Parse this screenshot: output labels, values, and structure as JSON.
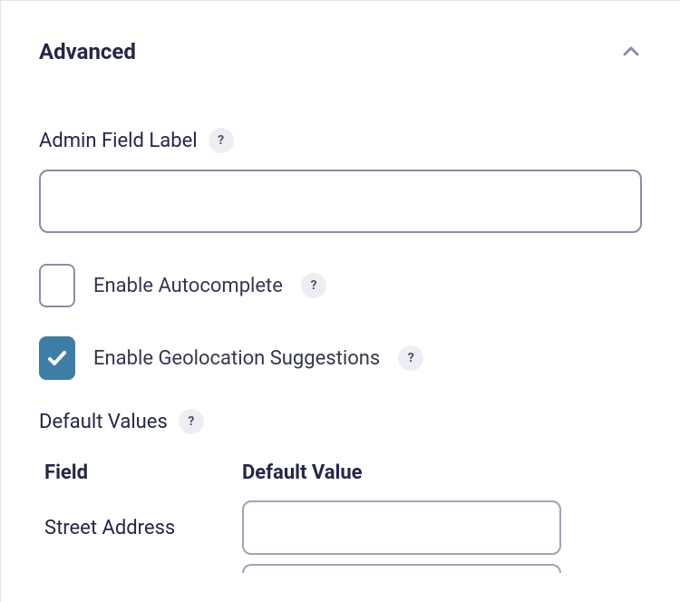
{
  "section": {
    "title": "Advanced"
  },
  "adminFieldLabel": {
    "label": "Admin Field Label",
    "value": "",
    "help": "?"
  },
  "autocomplete": {
    "label": "Enable Autocomplete",
    "checked": false,
    "help": "?"
  },
  "geolocation": {
    "label": "Enable Geolocation Suggestions",
    "checked": true,
    "help": "?"
  },
  "defaultValues": {
    "title": "Default Values",
    "help": "?",
    "columns": {
      "field": "Field",
      "value": "Default Value"
    },
    "rows": [
      {
        "field": "Street Address",
        "value": ""
      }
    ]
  }
}
